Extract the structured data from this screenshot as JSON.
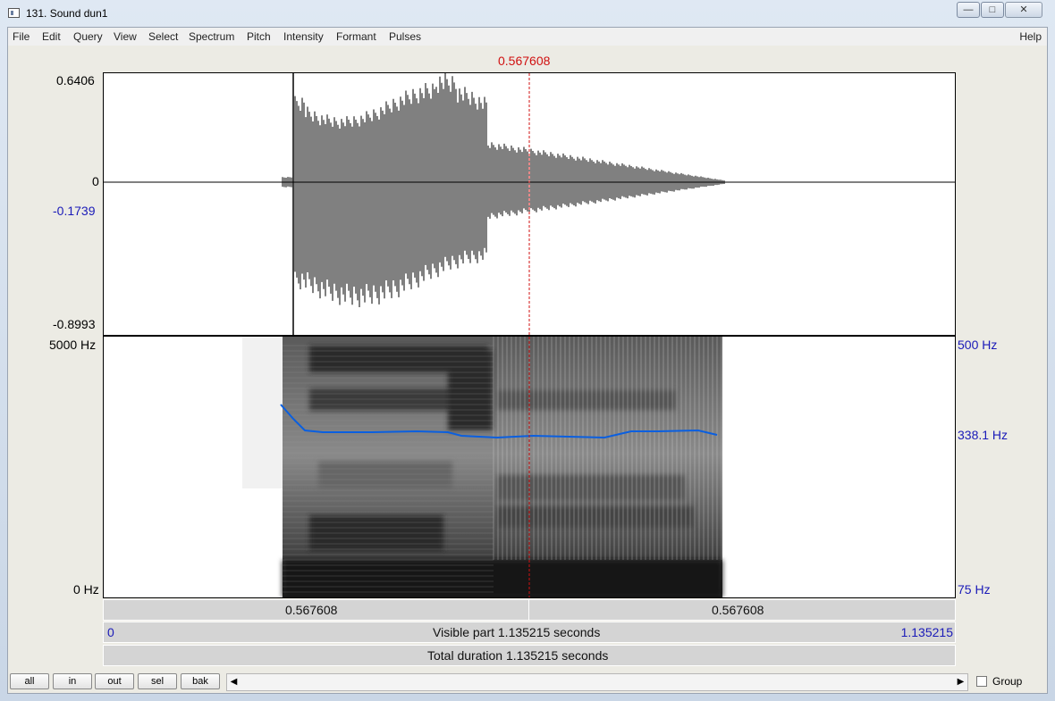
{
  "window": {
    "title": "131. Sound dun1",
    "controls": {
      "minimize_icon": "minimize-icon",
      "maximize_icon": "maximize-icon",
      "close_icon": "close-icon"
    }
  },
  "menu": {
    "items": [
      "File",
      "Edit",
      "Query",
      "View",
      "Select",
      "Spectrum",
      "Pitch",
      "Intensity",
      "Formant",
      "Pulses"
    ],
    "help": "Help"
  },
  "cursor": {
    "time_label": "0.567608",
    "time_s": 0.567608
  },
  "waveform": {
    "y_max": "0.6406",
    "y_zero": "0",
    "y_cursor": "-0.1739",
    "y_min": "-0.8993"
  },
  "spectrogram": {
    "freq_max": "5000 Hz",
    "freq_min": "0 Hz",
    "pitch_max": "500 Hz",
    "pitch_cursor": "338.1 Hz",
    "pitch_min": "75 Hz"
  },
  "rulers": {
    "selection_left": "0.567608",
    "selection_right": "0.567608",
    "visible_start": "0",
    "visible_part": "Visible part 1.135215 seconds",
    "visible_end": "1.135215",
    "total_duration": "Total duration 1.135215 seconds"
  },
  "bottom": {
    "buttons": [
      "all",
      "in",
      "out",
      "sel",
      "bak"
    ],
    "scroll_left_icon": "triangle-left-icon",
    "scroll_right_icon": "triangle-right-icon",
    "group_label": "Group",
    "group_checked": false
  },
  "colors": {
    "cursor": "#d01010",
    "pitch_curve": "#0a5fe0",
    "axis_blue": "#1a1ab8"
  }
}
